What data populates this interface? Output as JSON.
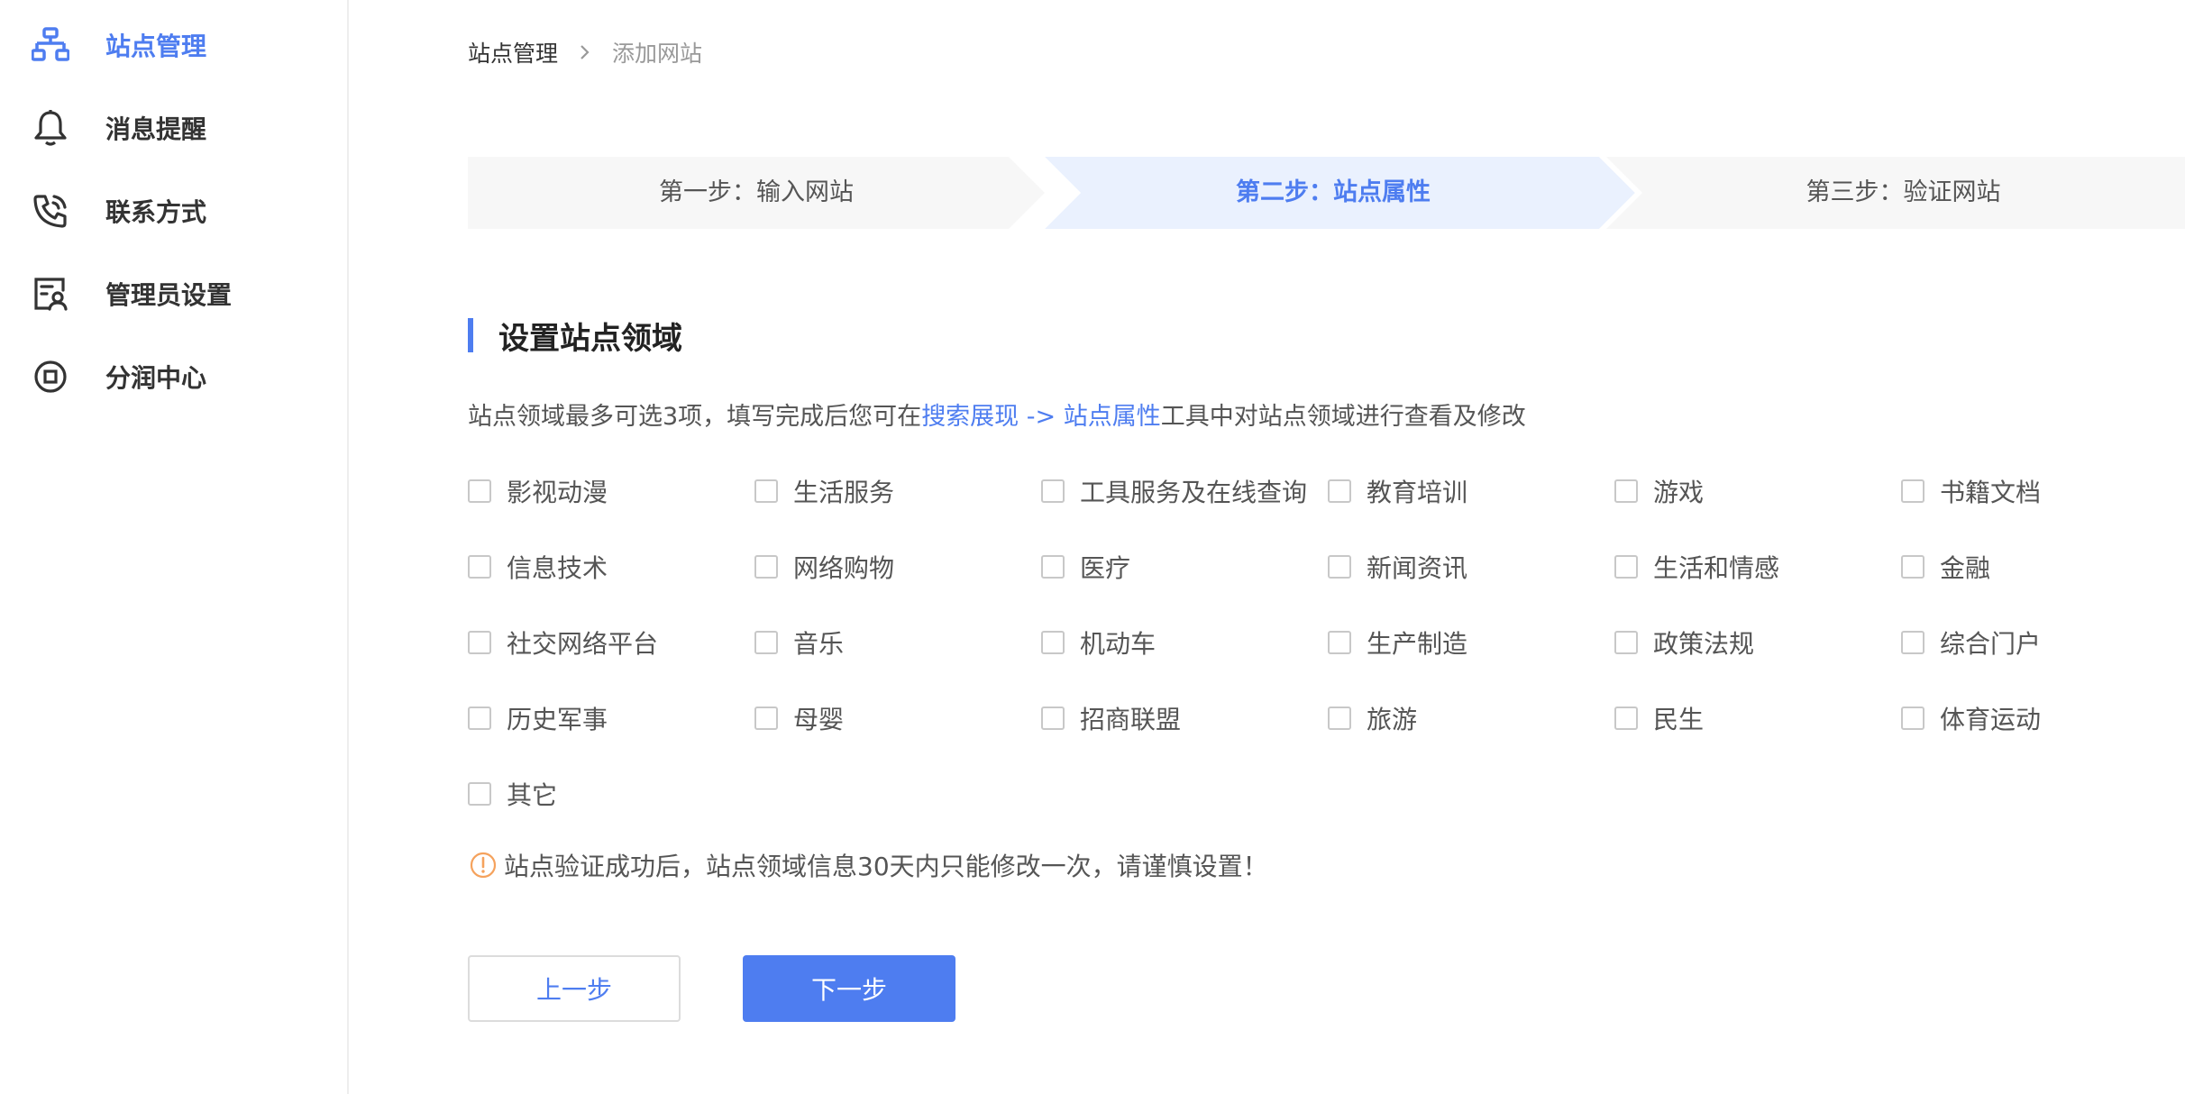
{
  "sidebar": {
    "items": [
      {
        "label": "站点管理",
        "icon": "sitemap-icon",
        "active": true
      },
      {
        "label": "消息提醒",
        "icon": "bell-icon",
        "active": false
      },
      {
        "label": "联系方式",
        "icon": "phone-icon",
        "active": false
      },
      {
        "label": "管理员设置",
        "icon": "admin-icon",
        "active": false
      },
      {
        "label": "分润中心",
        "icon": "revenue-icon",
        "active": false
      }
    ]
  },
  "breadcrumb": {
    "root": "站点管理",
    "current": "添加网站"
  },
  "steps": [
    {
      "label": "第一步：输入网站",
      "state": "done"
    },
    {
      "label": "第二步：站点属性",
      "state": "active"
    },
    {
      "label": "第三步：验证网站",
      "state": "pending"
    }
  ],
  "section": {
    "title": "设置站点领域",
    "desc_prefix": "站点领域最多可选3项，填写完成后您可在",
    "desc_link": "搜索展现 -> 站点属性",
    "desc_suffix": "工具中对站点领域进行查看及修改"
  },
  "categories": [
    "影视动漫",
    "生活服务",
    "工具服务及在线查询",
    "教育培训",
    "游戏",
    "书籍文档",
    "信息技术",
    "网络购物",
    "医疗",
    "新闻资讯",
    "生活和情感",
    "金融",
    "社交网络平台",
    "音乐",
    "机动车",
    "生产制造",
    "政策法规",
    "综合门户",
    "历史军事",
    "母婴",
    "招商联盟",
    "旅游",
    "民生",
    "体育运动",
    "其它"
  ],
  "warning": {
    "text": "站点验证成功后，站点领域信息30天内只能修改一次，请谨慎设置！"
  },
  "buttons": {
    "prev": "上一步",
    "next": "下一步"
  },
  "colors": {
    "accent": "#4e7df0",
    "warning": "#f5a25d",
    "step_bg": "#f7f7f7",
    "step_active_bg": "#eaf1fe"
  }
}
